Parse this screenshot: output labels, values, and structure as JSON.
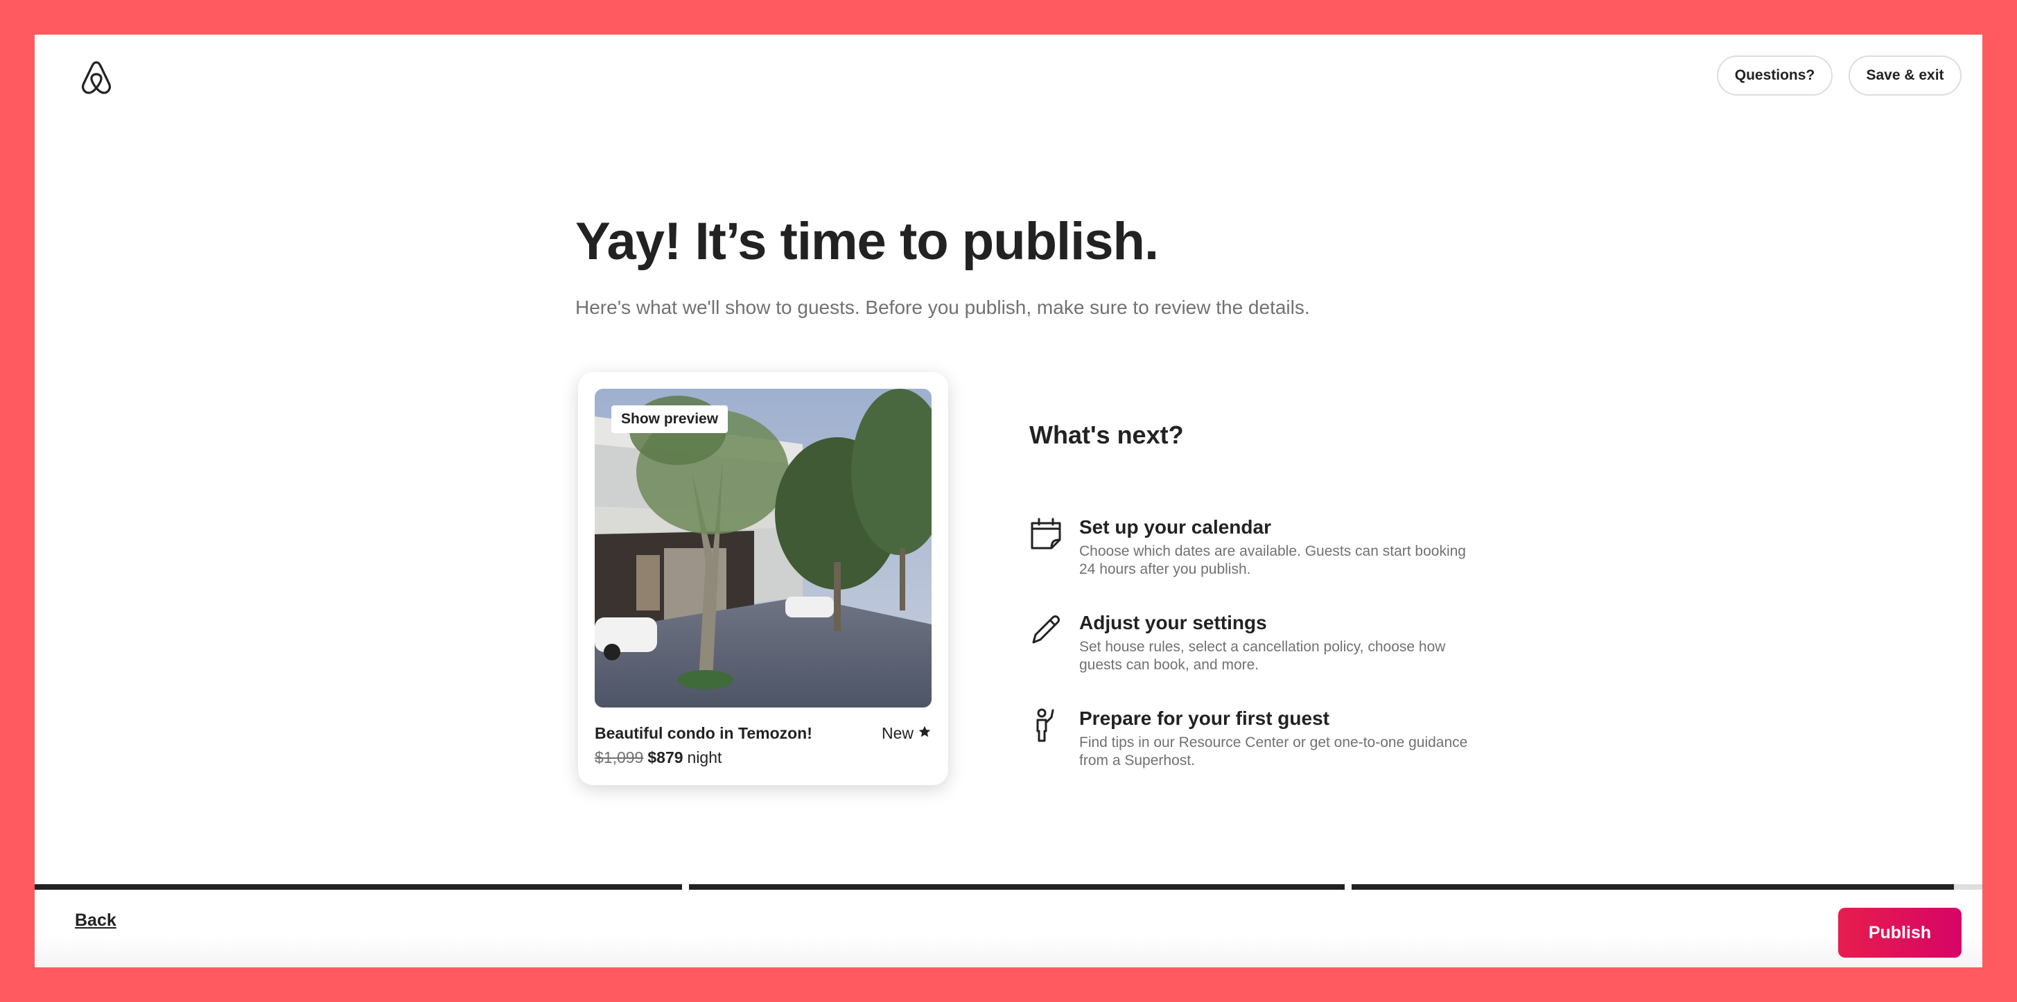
{
  "header": {
    "logo_icon": "airbnb-logo-icon",
    "questions_label": "Questions?",
    "save_exit_label": "Save & exit"
  },
  "main": {
    "headline": "Yay! It’s time to publish.",
    "subhead": "Here's what we'll show to guests. Before you publish, make sure to review the details."
  },
  "card": {
    "preview_label": "Show preview",
    "title": "Beautiful condo in Temozon!",
    "badge": "New",
    "badge_icon": "star-icon",
    "old_price": "$1,099",
    "price": "$879",
    "price_unit": "night"
  },
  "next": {
    "title": "What's next?",
    "steps": [
      {
        "icon": "calendar-icon",
        "title": "Set up your calendar",
        "desc": "Choose which dates are available. Guests can start booking 24 hours after you publish."
      },
      {
        "icon": "pencil-icon",
        "title": "Adjust your settings",
        "desc": "Set house rules, select a cancellation policy, choose how guests can book, and more."
      },
      {
        "icon": "person-waving-icon",
        "title": "Prepare for your first guest",
        "desc": "Find tips in our Resource Center or get one-to-one guidance from a Superhost."
      }
    ]
  },
  "progress": {
    "step1_fraction": 1.0,
    "step2_fraction": 1.0,
    "step3_fraction": 0.955
  },
  "footer": {
    "back_label": "Back",
    "publish_label": "Publish"
  },
  "colors": {
    "frame": "#FF5A5F",
    "publish_gradient_start": "#E61E4D",
    "publish_gradient_end": "#D70466",
    "text_primary": "#222222",
    "text_secondary": "#717171"
  }
}
